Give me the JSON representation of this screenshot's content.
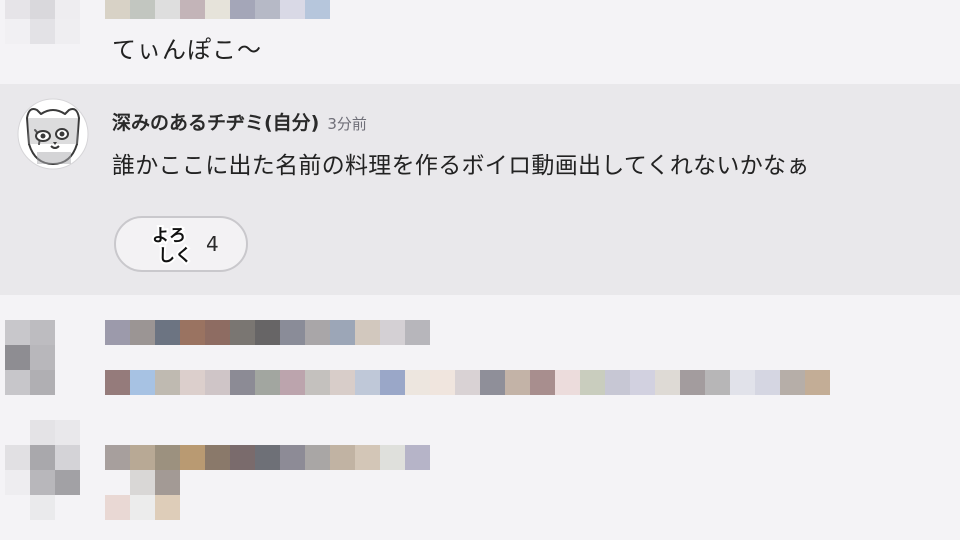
{
  "previous_message": {
    "text": "てぃんぽこ〜",
    "blurred_avatar_colors": [
      "#e6e4e8",
      "#d9d8dc",
      "#eeedf0",
      "#f1f0f3",
      "#e3e2e6",
      "#efeef1"
    ],
    "blurred_name_colors": [
      "#d8d2c6",
      "#c2c6c0",
      "#dedede",
      "#c3b4b8",
      "#e6e3da",
      "#a4a6b8",
      "#b6b9c6",
      "#d9d9e6",
      "#b6c6dc"
    ]
  },
  "highlighted_message": {
    "username": "深みのあるチヂミ(自分)",
    "timestamp": "3分前",
    "text": "誰かここに出た名前の料理を作るボイロ動画出してくれないかなぁ",
    "reaction": {
      "stamp_text_line1": "よろ",
      "stamp_text_line2": "しく",
      "count": "4"
    }
  },
  "blurred_message_1": {
    "avatar_colors": [
      "#c8c7cb",
      "#bdbcc0",
      "#f4f3f6",
      "#8e8d92",
      "#b8b7bb",
      "#f4f3f6",
      "#c7c6ca",
      "#b0afb3",
      "#f4f3f6"
    ],
    "name_colors": [
      "#9c9aab",
      "#9b9594",
      "#6c7482",
      "#9a7361",
      "#8e6c62",
      "#7a7672",
      "#676566",
      "#8a8c98",
      "#a9a6a8",
      "#9ca6b7",
      "#d2c8be",
      "#d4d0d4",
      "#b7b6bb"
    ],
    "text_colors": [
      "#957b7b",
      "#a7c2e3",
      "#bfbab1",
      "#dccfcc",
      "#cfc5c7",
      "#8c8b95",
      "#a2a6a0",
      "#bca4ad",
      "#c4c1be",
      "#d8cdc9",
      "#bfc8d8",
      "#9aa7c8",
      "#ede6df",
      "#f0e5de",
      "#d9d2d4",
      "#8f8f99",
      "#c3b3a7",
      "#a88e8e",
      "#ecdcdc",
      "#c9cdbe",
      "#c7c7d4",
      "#d2d1e0",
      "#dedad5",
      "#a39c9e",
      "#b7b6b7",
      "#e1e2ea",
      "#d5d6e2",
      "#b6aea8",
      "#c3ad96"
    ]
  },
  "blurred_message_2": {
    "avatar_colors": [
      "#f4f3f6",
      "#e4e3e6",
      "#e9e8eb",
      "#e1e0e3",
      "#a9a8ac",
      "#d4d3d7",
      "#eeedf0",
      "#b8b7bb",
      "#a2a1a5",
      "#f4f3f6",
      "#eaeaec",
      "#f4f3f6"
    ],
    "name_colors": [
      "#a79f9d",
      "#b8a995",
      "#9c917f",
      "#b99a72",
      "#8a796a",
      "#7a6b6c",
      "#6e7077",
      "#8d8b96",
      "#a9a6a5",
      "#c1b3a3",
      "#d3c6b7",
      "#dfe0dc",
      "#b6b4c8"
    ],
    "text_row_1": [
      "#f4f3f6",
      "#d9d7d6",
      "#a39a95"
    ],
    "text_row_2": [
      "#e9d8d4",
      "#ececec",
      "#decdb9"
    ]
  }
}
